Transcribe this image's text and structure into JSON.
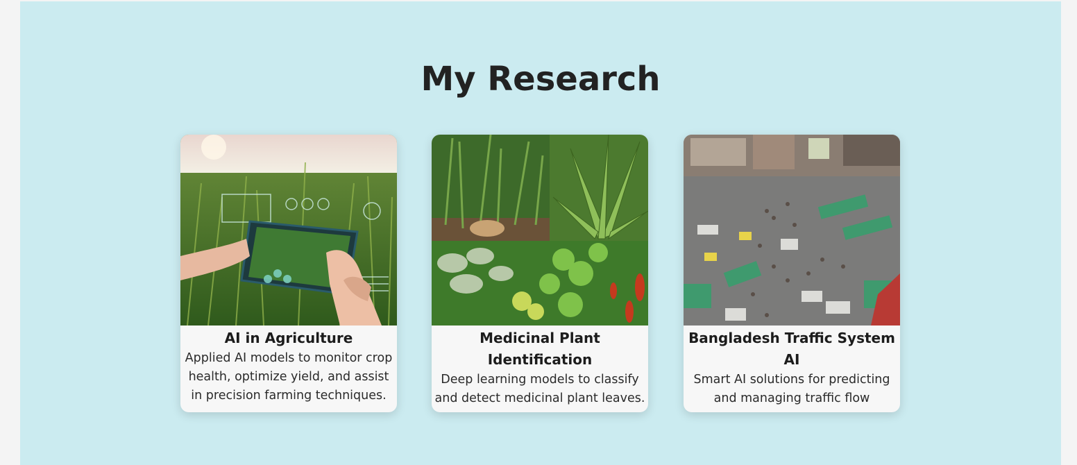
{
  "section": {
    "title": "My Research",
    "background": "#cbebf0"
  },
  "cards": [
    {
      "title": "AI in Agriculture",
      "description": "Applied AI models to monitor crop health, optimize yield, and assist in precision farming techniques.",
      "image_icon": "agriculture-photo"
    },
    {
      "title": "Medicinal Plant Identification",
      "description": "Deep learning models to classify and detect medicinal plant leaves.",
      "image_icon": "medicinal-plants-photo"
    },
    {
      "title": "Bangladesh Traffic System AI",
      "description": "Smart AI solutions for predicting and managing traffic flow",
      "image_icon": "traffic-photo"
    }
  ]
}
